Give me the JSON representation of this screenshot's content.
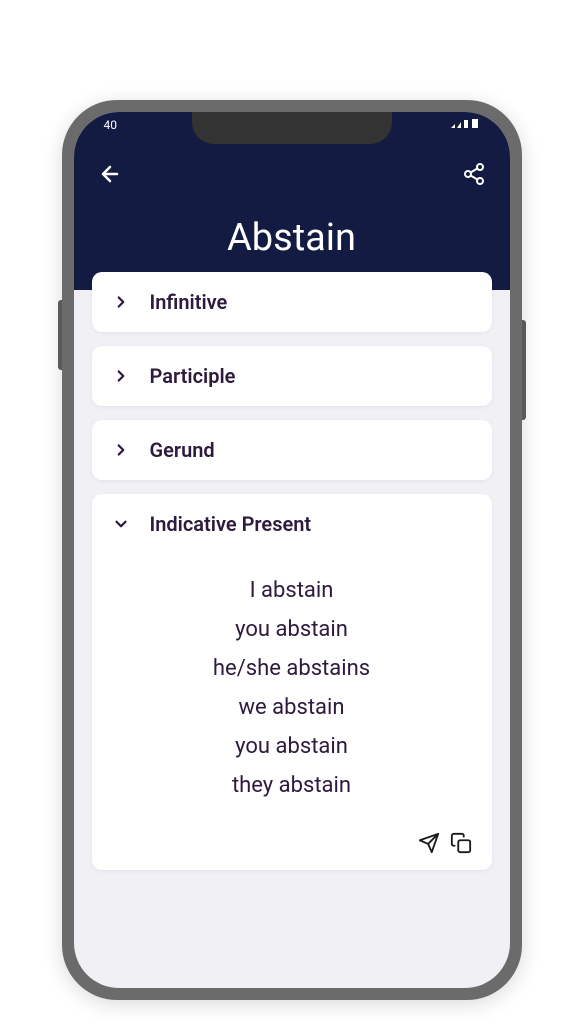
{
  "statusBar": {
    "time": "40"
  },
  "header": {
    "title": "Abstain"
  },
  "sections": {
    "infinitive": {
      "label": "Infinitive"
    },
    "participle": {
      "label": "Participle"
    },
    "gerund": {
      "label": "Gerund"
    },
    "indicativePresent": {
      "label": "Indicative Present",
      "lines": [
        "I abstain",
        "you abstain",
        "he/she abstains",
        "we abstain",
        "you abstain",
        "they abstain"
      ]
    }
  }
}
